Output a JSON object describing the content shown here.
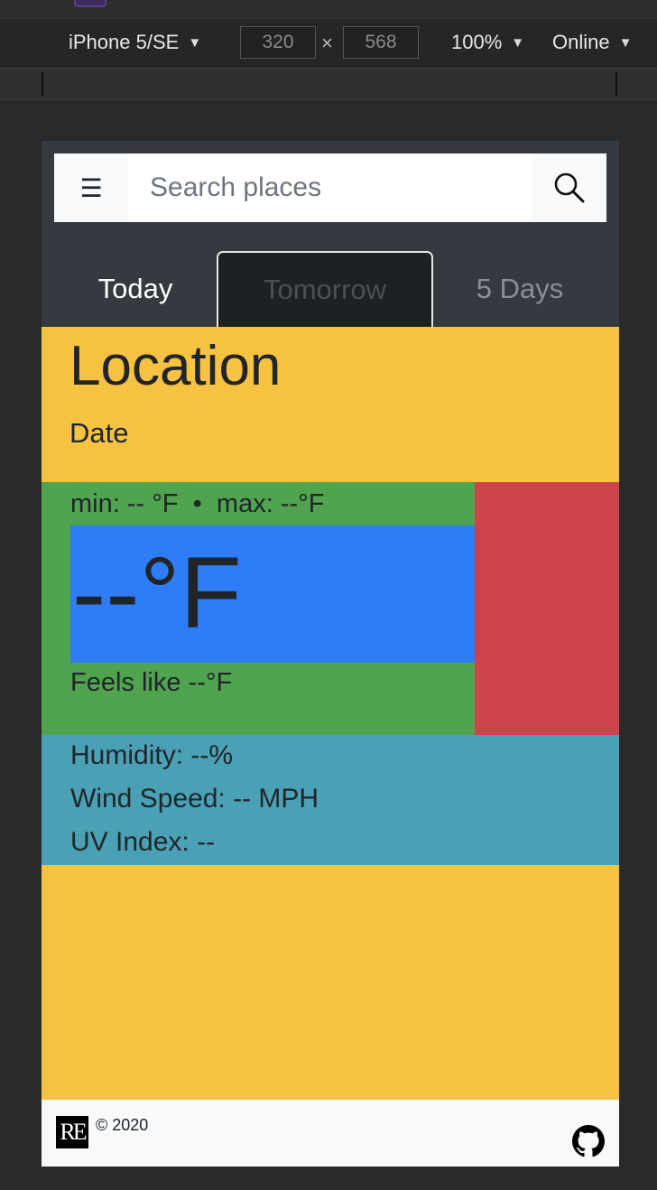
{
  "devtools": {
    "device": "iPhone 5/SE",
    "width": "320",
    "height": "568",
    "zoom": "100%",
    "network": "Online",
    "times": "×",
    "caret": "▼"
  },
  "app": {
    "menu_icon": "☰",
    "search": {
      "placeholder": "Search places"
    },
    "tabs": [
      {
        "label": "Today"
      },
      {
        "label": "Tomorrow"
      },
      {
        "label": "5 Days"
      }
    ],
    "location": "Location",
    "date": "Date",
    "minmax": "min: -- °F  •  max: --°F",
    "temp": "--°F",
    "feels_like": "Feels like --°F",
    "humidity": "Humidity: --%",
    "wind": "Wind Speed: -- MPH",
    "uv": "UV Index: --",
    "footer": {
      "logo": "RE",
      "copyright": "© 2020"
    }
  },
  "colors": {
    "navbar": "#343a40",
    "yellow": "#f5c242",
    "green": "#50a34f",
    "red": "#ce434a",
    "blue": "#2e7cf6",
    "teal": "#4aa1b5"
  }
}
